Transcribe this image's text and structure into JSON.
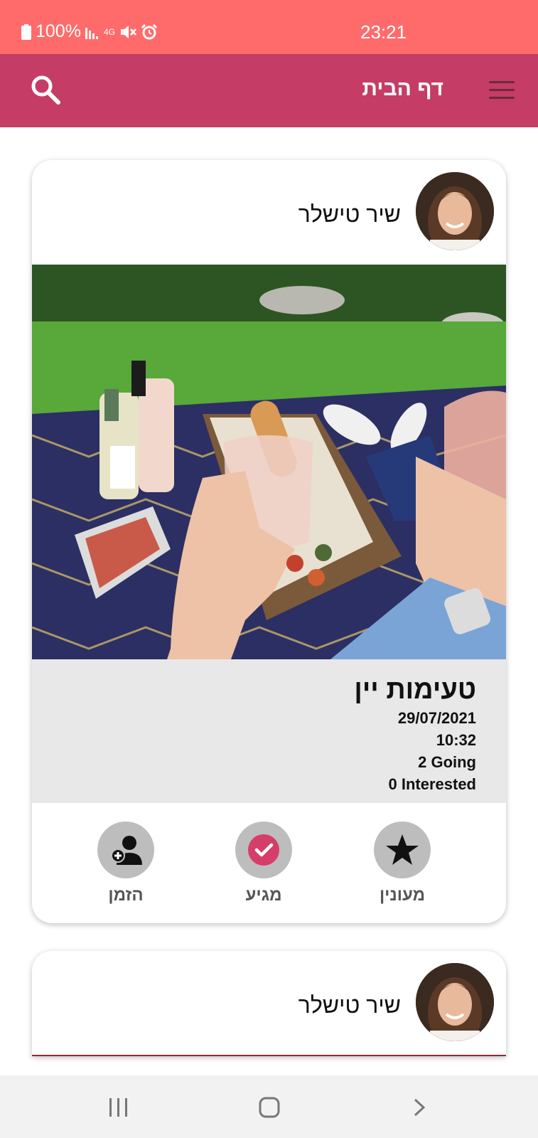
{
  "status_bar": {
    "battery": "100%",
    "network": "4G",
    "time": "23:21"
  },
  "app_bar": {
    "title": "דף הבית"
  },
  "colors": {
    "status_bar": "#ff6b6b",
    "app_bar": "#c53c66",
    "accent": "#d63e6a"
  },
  "posts": [
    {
      "author": "שיר טישלר",
      "event": {
        "title": "טעימות יין",
        "date": "29/07/2021",
        "time": "10:32",
        "going": "2 Going",
        "interested": "0 Interested"
      },
      "actions": [
        {
          "label": "מעונין",
          "icon": "star-icon"
        },
        {
          "label": "מגיע",
          "icon": "check-circle-icon"
        },
        {
          "label": "הזמן",
          "icon": "add-person-icon"
        }
      ]
    },
    {
      "author": "שיר טישלר"
    }
  ],
  "nav_bar": {
    "icons": [
      "recent-apps-icon",
      "home-icon",
      "back-icon"
    ]
  }
}
